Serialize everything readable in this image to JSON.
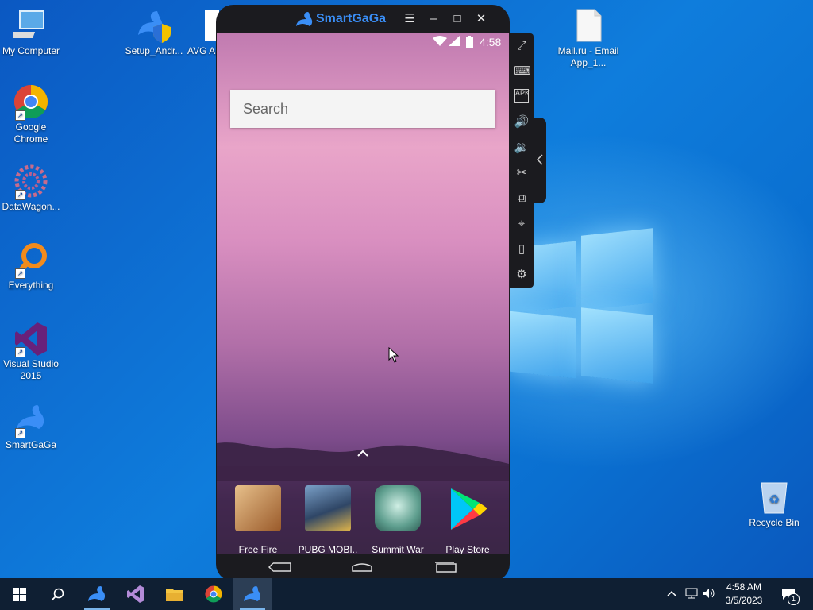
{
  "desktop": {
    "icons": [
      {
        "label": "My Computer"
      },
      {
        "label": "Google Chrome"
      },
      {
        "label": "DataWagon..."
      },
      {
        "label": "Everything"
      },
      {
        "label": "Visual Studio 2015"
      },
      {
        "label": "SmartGaGa"
      },
      {
        "label": "Setup_Andr..."
      },
      {
        "label": "AVG Ar... & Secu..."
      },
      {
        "label": "Mail.ru - Email App_1..."
      },
      {
        "label": "Recycle Bin"
      }
    ]
  },
  "emulator": {
    "title": "SmartGaGa",
    "status_time": "4:58",
    "search_placeholder": "Search",
    "apps": [
      {
        "label": "Free Fire"
      },
      {
        "label": "PUBG MOBI.."
      },
      {
        "label": "Summit War"
      },
      {
        "label": "Play Store"
      }
    ],
    "sidebar_icons": [
      "fullscreen-icon",
      "keyboard-icon",
      "apk-install-icon",
      "volume-up-icon",
      "volume-down-icon",
      "screenshot-scissors-icon",
      "multi-instance-icon",
      "location-icon",
      "shake-icon",
      "settings-icon"
    ]
  },
  "taskbar": {
    "clock_time": "4:58 AM",
    "clock_date": "3/5/2023",
    "notification_count": "1"
  },
  "colors": {
    "brand_blue": "#3a8ef6",
    "taskbar": "#0f1f33",
    "desktop_blue": "#0f7ddc"
  }
}
